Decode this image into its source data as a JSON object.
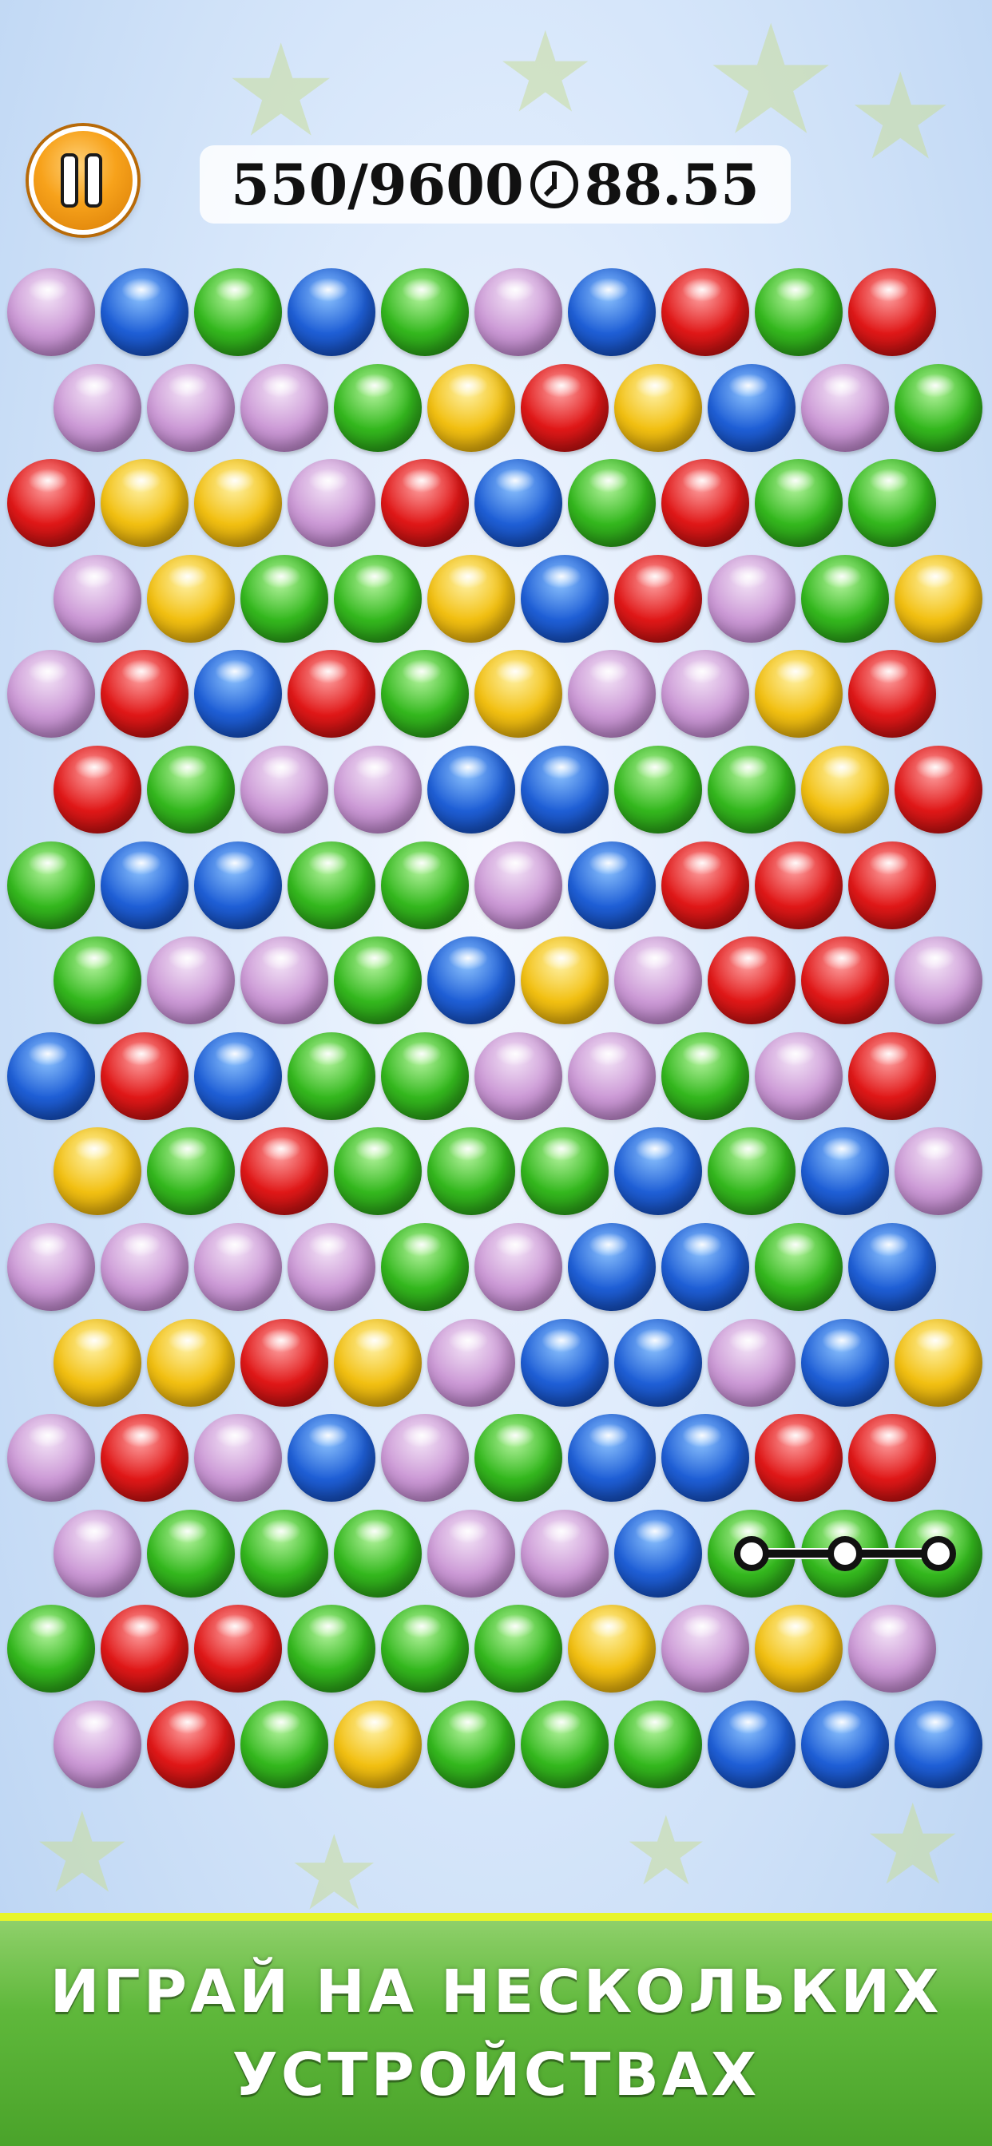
{
  "hud": {
    "score": "550/9600",
    "time": "88.55",
    "pause_icon": "pause-icon",
    "clock_icon": "clock-icon"
  },
  "board": {
    "rows": [
      [
        "purple",
        "blue",
        "green",
        "blue",
        "green",
        "purple",
        "blue",
        "red",
        "green",
        "red"
      ],
      [
        "purple",
        "purple",
        "purple",
        "green",
        "yellow",
        "red",
        "yellow",
        "blue",
        "purple",
        "green"
      ],
      [
        "red",
        "yellow",
        "yellow",
        "purple",
        "red",
        "blue",
        "green",
        "red",
        "green",
        "green"
      ],
      [
        "purple",
        "yellow",
        "green",
        "green",
        "yellow",
        "blue",
        "red",
        "purple",
        "green",
        "yellow"
      ],
      [
        "purple",
        "red",
        "blue",
        "red",
        "green",
        "yellow",
        "purple",
        "purple",
        "yellow",
        "red"
      ],
      [
        "red",
        "green",
        "purple",
        "purple",
        "blue",
        "blue",
        "green",
        "green",
        "yellow",
        "red"
      ],
      [
        "green",
        "blue",
        "blue",
        "green",
        "green",
        "purple",
        "blue",
        "red",
        "red",
        "red"
      ],
      [
        "green",
        "purple",
        "purple",
        "green",
        "blue",
        "yellow",
        "purple",
        "red",
        "red",
        "purple"
      ],
      [
        "blue",
        "red",
        "blue",
        "green",
        "green",
        "purple",
        "purple",
        "green",
        "purple",
        "red"
      ],
      [
        "yellow",
        "green",
        "red",
        "green",
        "green",
        "green",
        "blue",
        "green",
        "blue",
        "purple"
      ],
      [
        "purple",
        "purple",
        "purple",
        "purple",
        "green",
        "purple",
        "blue",
        "blue",
        "green",
        "blue"
      ],
      [
        "yellow",
        "yellow",
        "red",
        "yellow",
        "purple",
        "blue",
        "blue",
        "purple",
        "blue",
        "yellow"
      ],
      [
        "purple",
        "red",
        "purple",
        "blue",
        "purple",
        "green",
        "blue",
        "blue",
        "red",
        "red"
      ],
      [
        "purple",
        "green",
        "green",
        "green",
        "purple",
        "purple",
        "blue",
        "green",
        "green",
        "green"
      ],
      [
        "green",
        "red",
        "red",
        "green",
        "green",
        "green",
        "yellow",
        "purple",
        "yellow",
        "purple"
      ],
      [
        "purple",
        "red",
        "green",
        "yellow",
        "green",
        "green",
        "green",
        "blue",
        "blue",
        "blue"
      ]
    ],
    "selection_chain": [
      [
        13,
        7
      ],
      [
        13,
        8
      ],
      [
        13,
        9
      ]
    ]
  },
  "promo": {
    "line1": "ИГРАЙ НА НЕСКОЛЬКИХ",
    "line2": "УСТРОЙСТВАХ"
  }
}
